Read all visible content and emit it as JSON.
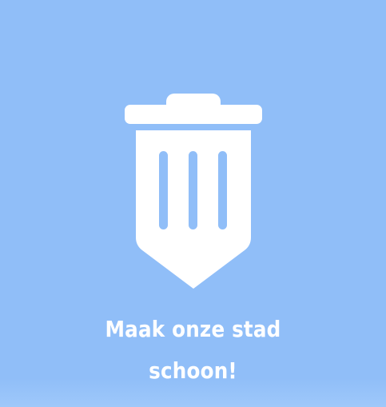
{
  "splash": {
    "background_color": "#90bef8",
    "logo_icon": "trash-bin-icon",
    "logo_color": "#ffffff",
    "tagline_line1": "Maak onze stad",
    "tagline_line2": "schoon!"
  }
}
